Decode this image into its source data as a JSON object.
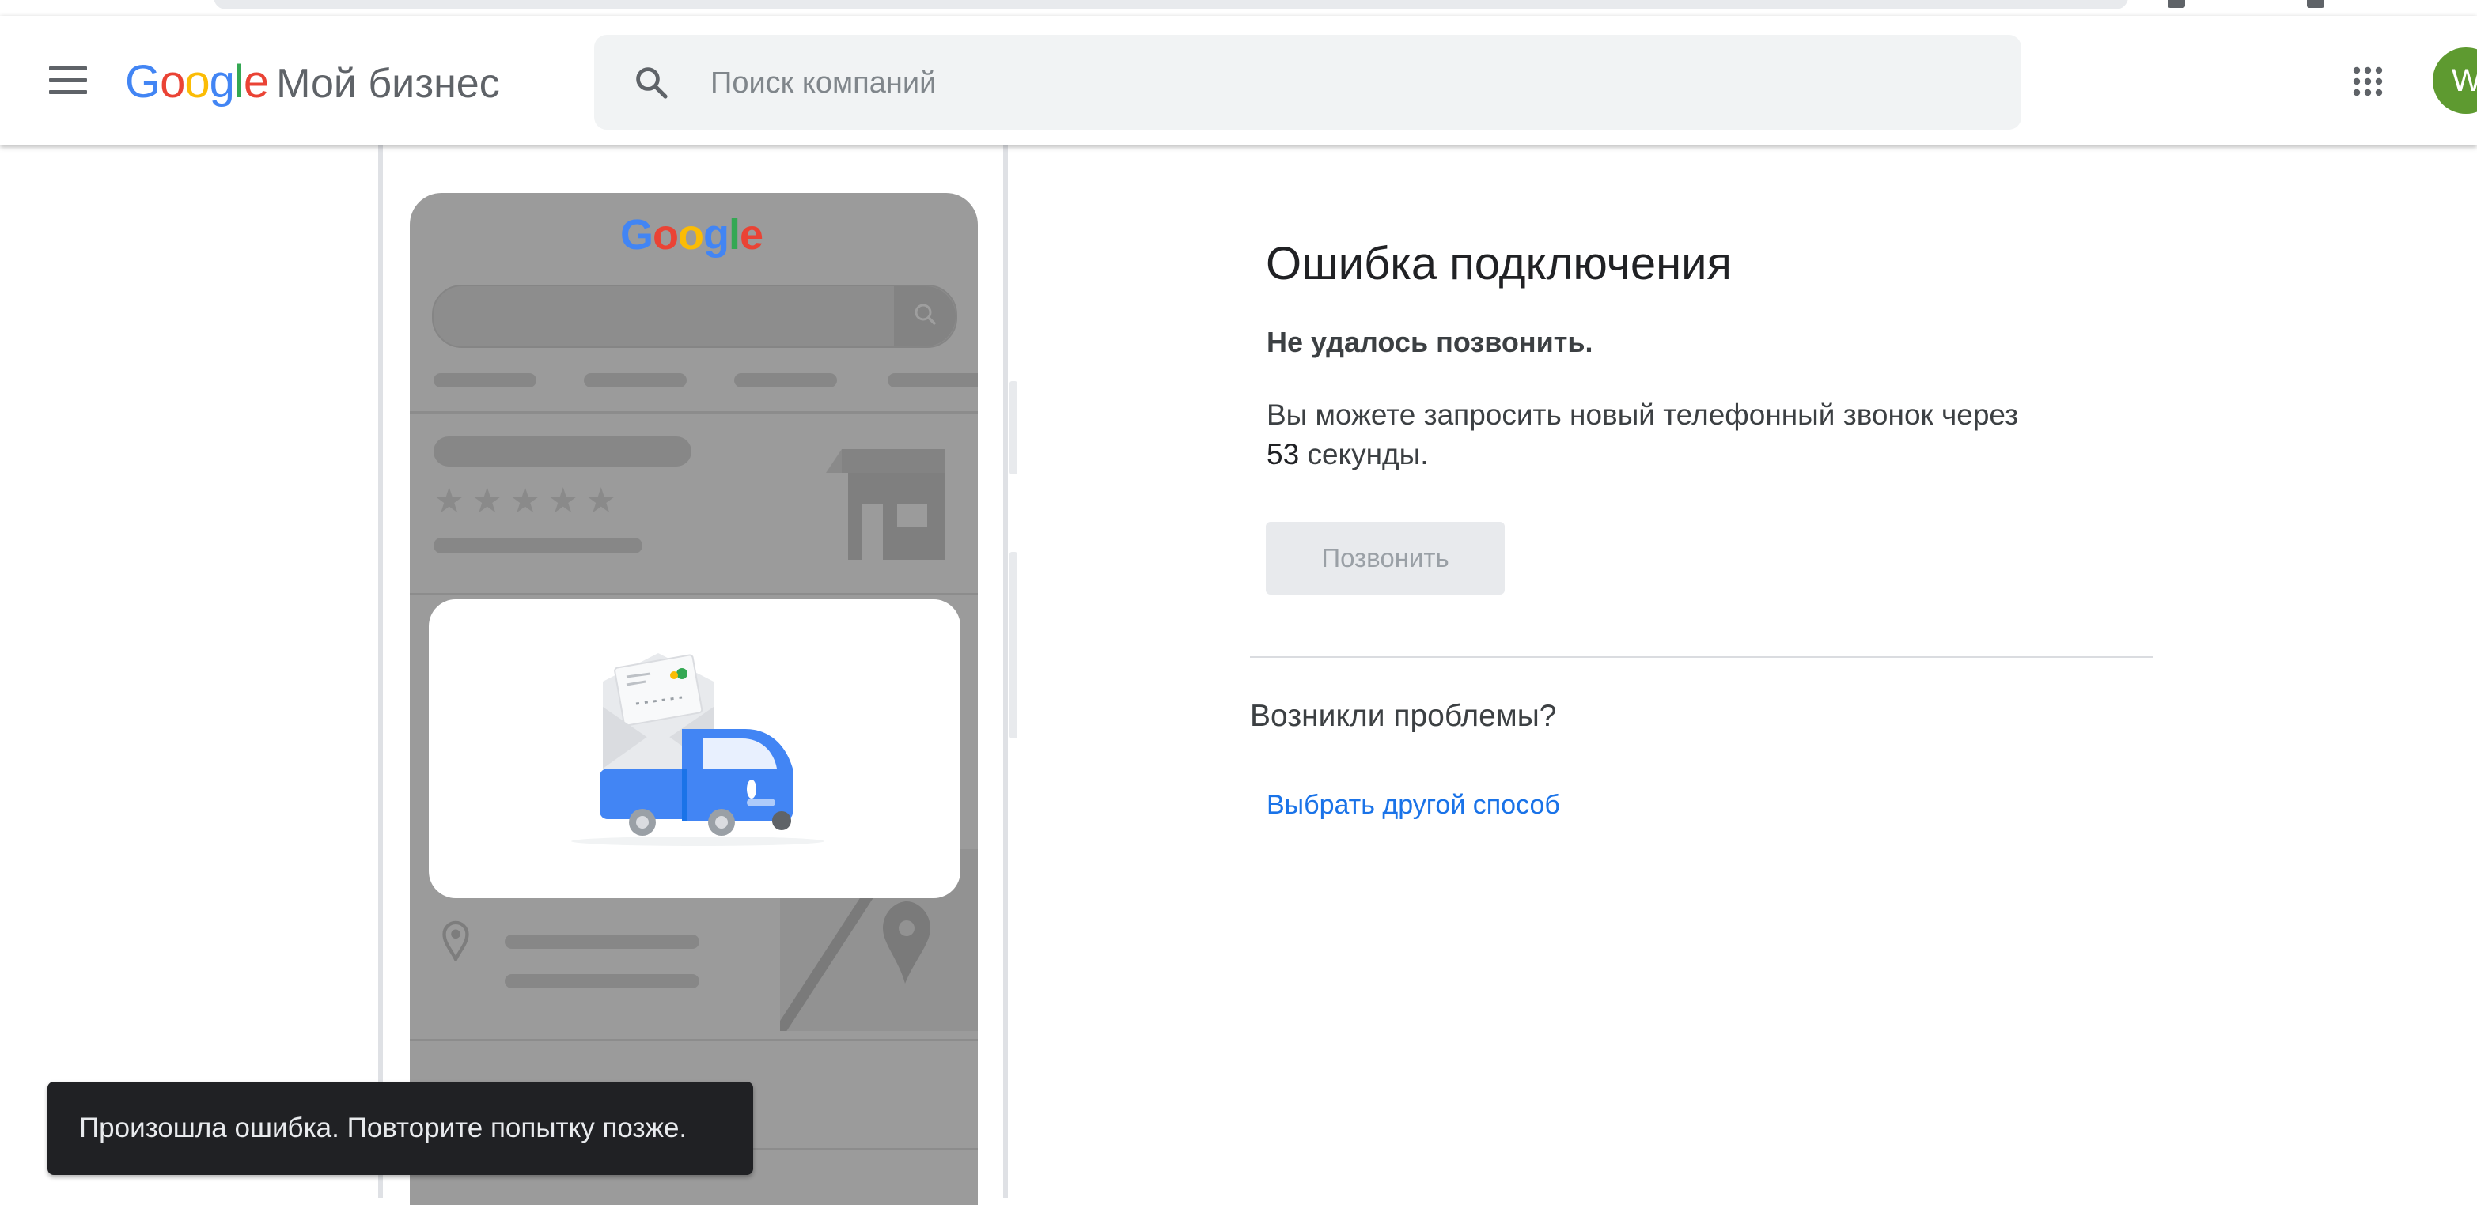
{
  "header": {
    "logo_text": "Google",
    "product_name": "Мой бизнес",
    "search_placeholder": "Поиск компаний",
    "avatar_letter": "W"
  },
  "illustration": {
    "mock_logo": "Google"
  },
  "main": {
    "title": "Ошибка подключения",
    "subtitle": "Не удалось позвонить.",
    "info_prefix": "Вы можете запросить новый телефонный звонок через",
    "countdown": "53",
    "info_suffix": "секунды.",
    "call_button": "Позвонить",
    "problems_heading": "Возникли проблемы?",
    "other_method_link": "Выбрать другой способ"
  },
  "snackbar": {
    "message": "Произошла ошибка. Повторите попытку позже."
  },
  "colors": {
    "google_blue": "#4285F4",
    "google_red": "#EA4335",
    "google_yellow": "#FBBC05",
    "google_green": "#34A853",
    "link": "#1a73e8",
    "avatar": "#5e9a30"
  },
  "icons": [
    "menu-icon",
    "search-icon",
    "apps-grid-icon",
    "location-pin-icon",
    "store-icon",
    "truck-envelope-illustration"
  ]
}
